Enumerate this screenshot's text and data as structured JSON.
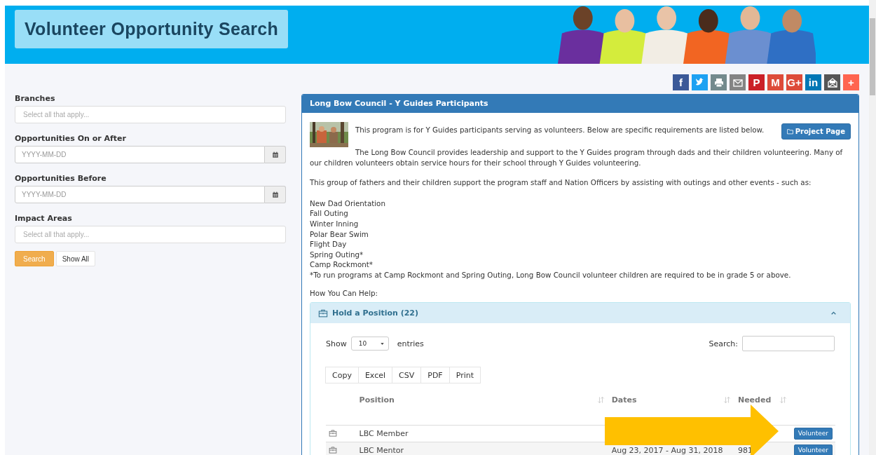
{
  "header": {
    "title": "Volunteer Opportunity Search",
    "banner": {
      "kind": "picture"
    }
  },
  "share_buttons": [
    {
      "kind": "facebook",
      "glyph": "f"
    },
    {
      "kind": "twitter"
    },
    {
      "kind": "print"
    },
    {
      "kind": "email"
    },
    {
      "kind": "pinterest",
      "glyph": "P"
    },
    {
      "kind": "gmail",
      "glyph": "M"
    },
    {
      "kind": "googleplus",
      "glyph": "G+"
    },
    {
      "kind": "linkedin",
      "glyph": "in"
    },
    {
      "kind": "mailer"
    },
    {
      "kind": "more",
      "glyph": "+"
    }
  ],
  "sidebar": {
    "fields": [
      {
        "label": "Branches",
        "kind": "select",
        "placeholder": "Select all that apply..."
      },
      {
        "label": "Opportunities On or After",
        "kind": "date",
        "placeholder": "YYYY-MM-DD"
      },
      {
        "label": "Opportunities Before",
        "kind": "date",
        "placeholder": "YYYY-MM-DD"
      },
      {
        "label": "Impact Areas",
        "kind": "select",
        "placeholder": "Select all that apply..."
      }
    ],
    "buttons": [
      {
        "label": "Search",
        "kind": "primary"
      },
      {
        "label": "Show All",
        "kind": "default"
      }
    ]
  },
  "panel": {
    "title": "Long Bow Council - Y Guides Participants",
    "thumbnail": {
      "kind": "picture"
    },
    "project_button": "Project Page",
    "intro": "This program is for Y Guides participants serving as volunteers. Below are specific requirements are listed below.",
    "paragraphs": [
      "The Long Bow Council provides leadership and support to the Y Guides program through dads and their children volunteering. Many of our children volunteers obtain service hours for their school through Y Guides volunteering.",
      "This group of fathers and their children support the program staff and Nation Officers by assisting with outings and other events - such as:"
    ],
    "events": [
      "New Dad Orientation",
      "Fall Outing",
      "Winter Inning",
      "Polar Bear Swim",
      "Flight Day",
      "Spring Outing*",
      "Camp Rockmont*"
    ],
    "footnote": "*To run programs at Camp Rockmont and Spring Outing, Long Bow Council volunteer children are required to be in grade 5 or above.",
    "help_label": "How You Can Help:",
    "section": {
      "title": "Hold a Position (22)",
      "expanded": true,
      "show_label": "Show",
      "page_size": "10",
      "entries_label": "entries",
      "search_label": "Search:",
      "export_buttons": [
        "Copy",
        "Excel",
        "CSV",
        "PDF",
        "Print"
      ],
      "columns": [
        "Position",
        "Dates",
        "Needed"
      ],
      "rows": [
        {
          "position": "LBC Member",
          "action": "Volunteer"
        },
        {
          "position": "LBC Mentor",
          "dates": "Aug 23, 2017 - Aug 31, 2018",
          "needed": "981",
          "action": "Volunteer"
        }
      ]
    }
  }
}
